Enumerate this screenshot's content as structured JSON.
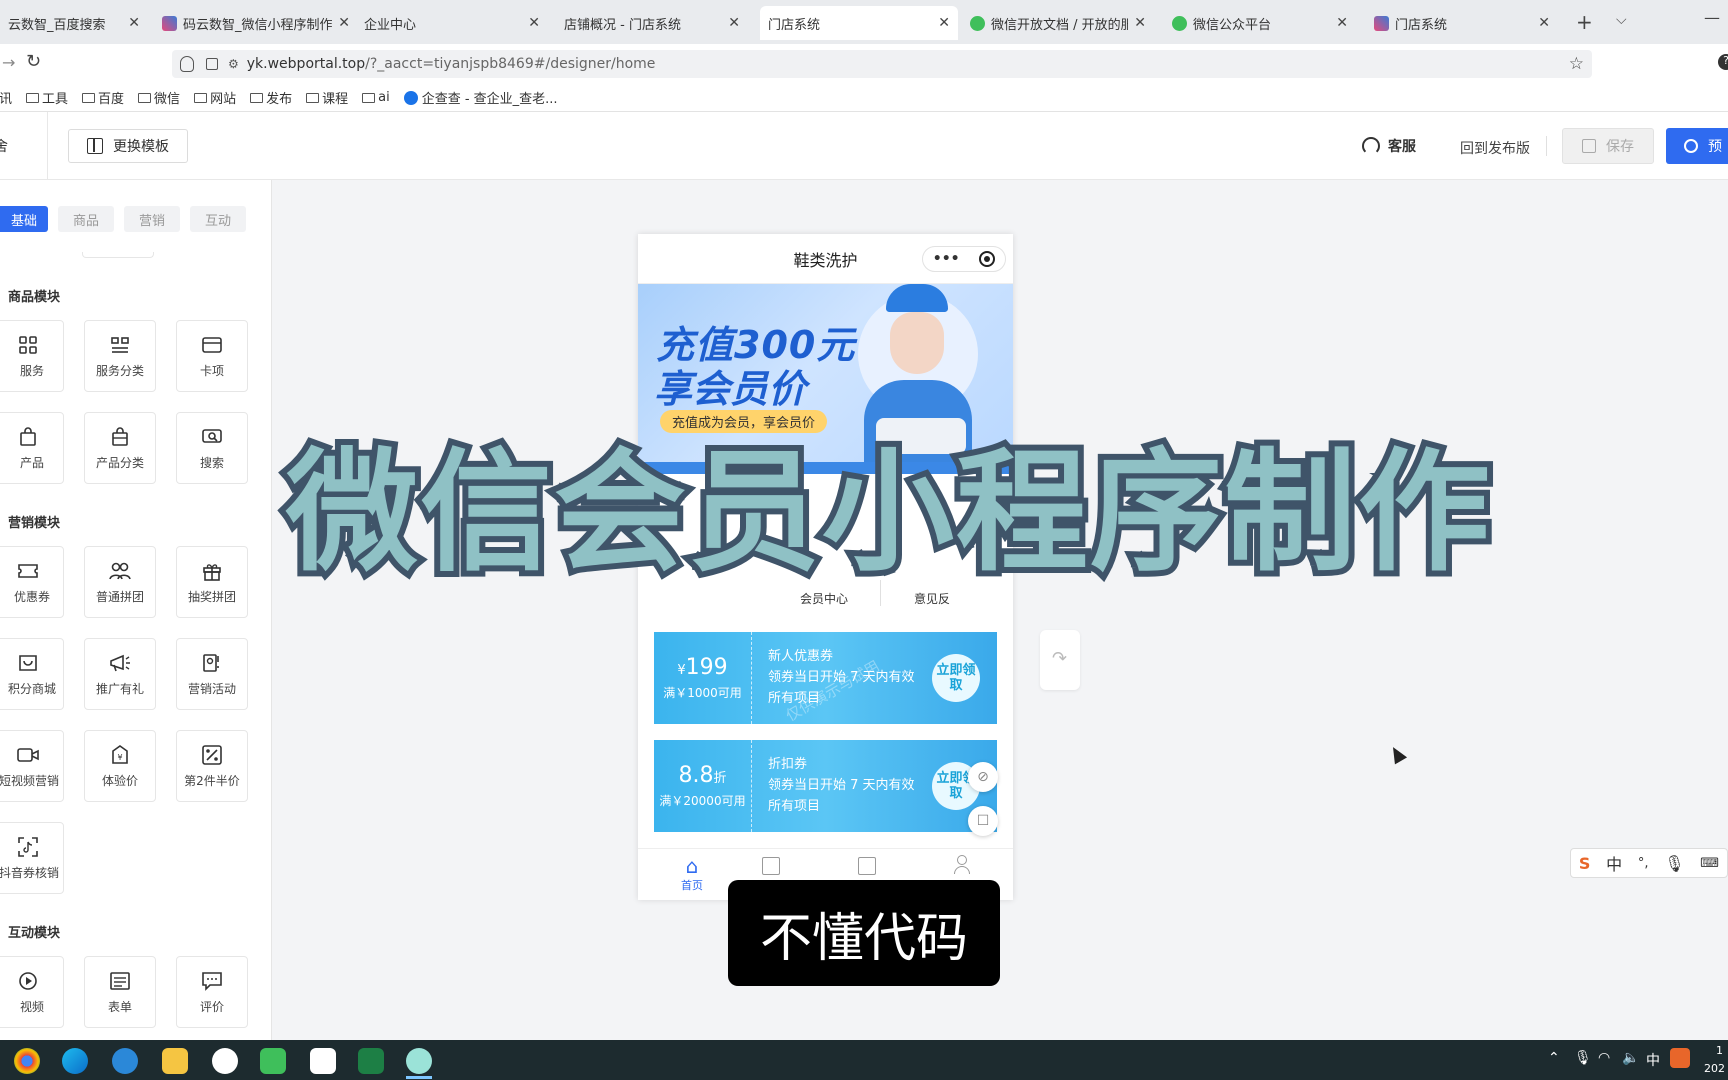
{
  "browser": {
    "tabs": [
      {
        "label": "云数智_百度搜索",
        "active": false
      },
      {
        "label": "码云数智_微信小程序制作与",
        "active": false
      },
      {
        "label": "企业中心",
        "active": false
      },
      {
        "label": "店铺概况 - 门店系统",
        "active": false
      },
      {
        "label": "门店系统",
        "active": true
      },
      {
        "label": "微信开放文档 / 开放的服务",
        "active": false
      },
      {
        "label": "微信公众平台",
        "active": false
      },
      {
        "label": "门店系统",
        "active": false
      }
    ],
    "close_glyph": "✕",
    "new_tab_glyph": "+",
    "url_host": "yk.webportal.top",
    "url_path": "/?_aacct=tiyanjspb8469#/designer/home",
    "bookmarks": [
      "资讯",
      "工具",
      "百度",
      "微信",
      "网站",
      "发布",
      "课程",
      "ai",
      "企查查 - 查企业_查老..."
    ]
  },
  "header": {
    "left_glyph": "舍",
    "change_template": "更换模板",
    "service": "客服",
    "back_release": "回到发布版",
    "save": "保存",
    "preview": "预"
  },
  "sidebar": {
    "category_tabs": [
      "基础",
      "商品",
      "营销",
      "互动"
    ],
    "sections": [
      {
        "title": "商品模块",
        "items": [
          "服务",
          "服务分类",
          "卡项",
          "产品",
          "产品分类",
          "搜索"
        ]
      },
      {
        "title": "营销模块",
        "items": [
          "优惠券",
          "普通拼团",
          "抽奖拼团",
          "积分商城",
          "推广有礼",
          "营销活动",
          "短视频营销",
          "体验价",
          "第2件半价",
          "抖音券核销"
        ]
      },
      {
        "title": "互动模块",
        "items": [
          "视频",
          "表单",
          "评价"
        ]
      }
    ]
  },
  "phone": {
    "title": "鞋类洗护",
    "banner_line1": "充值300元",
    "banner_line2": "享会员价",
    "banner_tag": "充值成为会员，享会员价",
    "nav_labels": [
      "会员中心",
      "意见反"
    ],
    "coupons": [
      {
        "currency": "¥",
        "value": "199",
        "cond": "满￥1000可用",
        "title": "新人优惠券",
        "line2": "领券当日开始 7 天内有效",
        "line3": "所有项目",
        "action": "立即领取"
      },
      {
        "currency": "",
        "value": "8.8",
        "unit": "折",
        "cond": "满￥20000可用",
        "title": "折扣券",
        "line2": "领券当日开始 7 天内有效",
        "line3": "所有项目",
        "action": "立即领取"
      }
    ],
    "bottom_nav_home": "首页",
    "watermark": "仅供演示与试用"
  },
  "overlay": {
    "headline": "微信会员小程序制作",
    "caption": "不懂代码"
  },
  "ime": {
    "lang": "中"
  },
  "tray": {
    "lang": "中",
    "time": "1",
    "date": "202"
  },
  "colors": {
    "primary": "#2f6bf0",
    "coupon": "#3bb4ee",
    "headline_fill": "#8fc1c5",
    "headline_stroke": "#3f5469"
  }
}
